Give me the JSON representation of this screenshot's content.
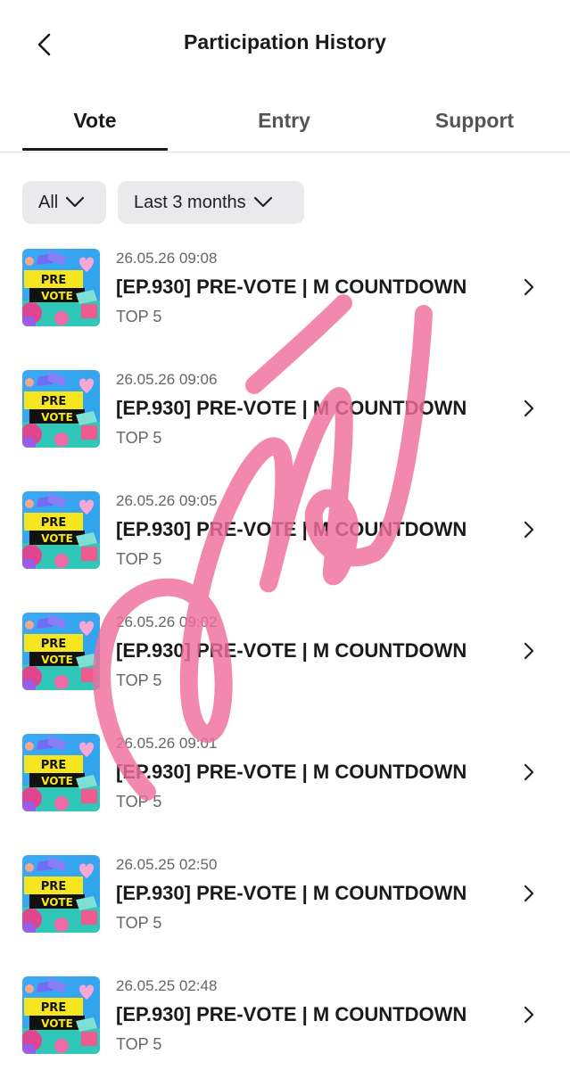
{
  "header": {
    "title": "Participation History",
    "back_icon": "chevron-left-icon"
  },
  "tabs": [
    {
      "label": "Vote",
      "active": true
    },
    {
      "label": "Entry",
      "active": false
    },
    {
      "label": "Support",
      "active": false
    }
  ],
  "filters": [
    {
      "label": "All",
      "icon": "chevron-down-icon"
    },
    {
      "label": "Last 3 months",
      "icon": "chevron-down-icon"
    }
  ],
  "thumbnail": {
    "line1": "PRE",
    "line2": "VOTE"
  },
  "items": [
    {
      "date": "26.05.26 09:08",
      "title": "[EP.930] PRE-VOTE | M COUNTDOWN",
      "sub": "TOP 5"
    },
    {
      "date": "26.05.26 09:06",
      "title": "[EP.930] PRE-VOTE | M COUNTDOWN",
      "sub": "TOP 5"
    },
    {
      "date": "26.05.26 09:05",
      "title": "[EP.930] PRE-VOTE | M COUNTDOWN",
      "sub": "TOP 5"
    },
    {
      "date": "26.05.26 09:02",
      "title": "[EP.930] PRE-VOTE | M COUNTDOWN",
      "sub": "TOP 5"
    },
    {
      "date": "26.05.26 09:01",
      "title": "[EP.930] PRE-VOTE | M COUNTDOWN",
      "sub": "TOP 5"
    },
    {
      "date": "26.05.25 02:50",
      "title": "[EP.930] PRE-VOTE | M COUNTDOWN",
      "sub": "TOP 5"
    },
    {
      "date": "26.05.25 02:48",
      "title": "[EP.930] PRE-VOTE | M COUNTDOWN",
      "sub": "TOP 5"
    }
  ],
  "colors": {
    "scribble": "#f06e9c",
    "active_underline": "#1a1a1a",
    "chip_bg": "#eaeaed"
  }
}
